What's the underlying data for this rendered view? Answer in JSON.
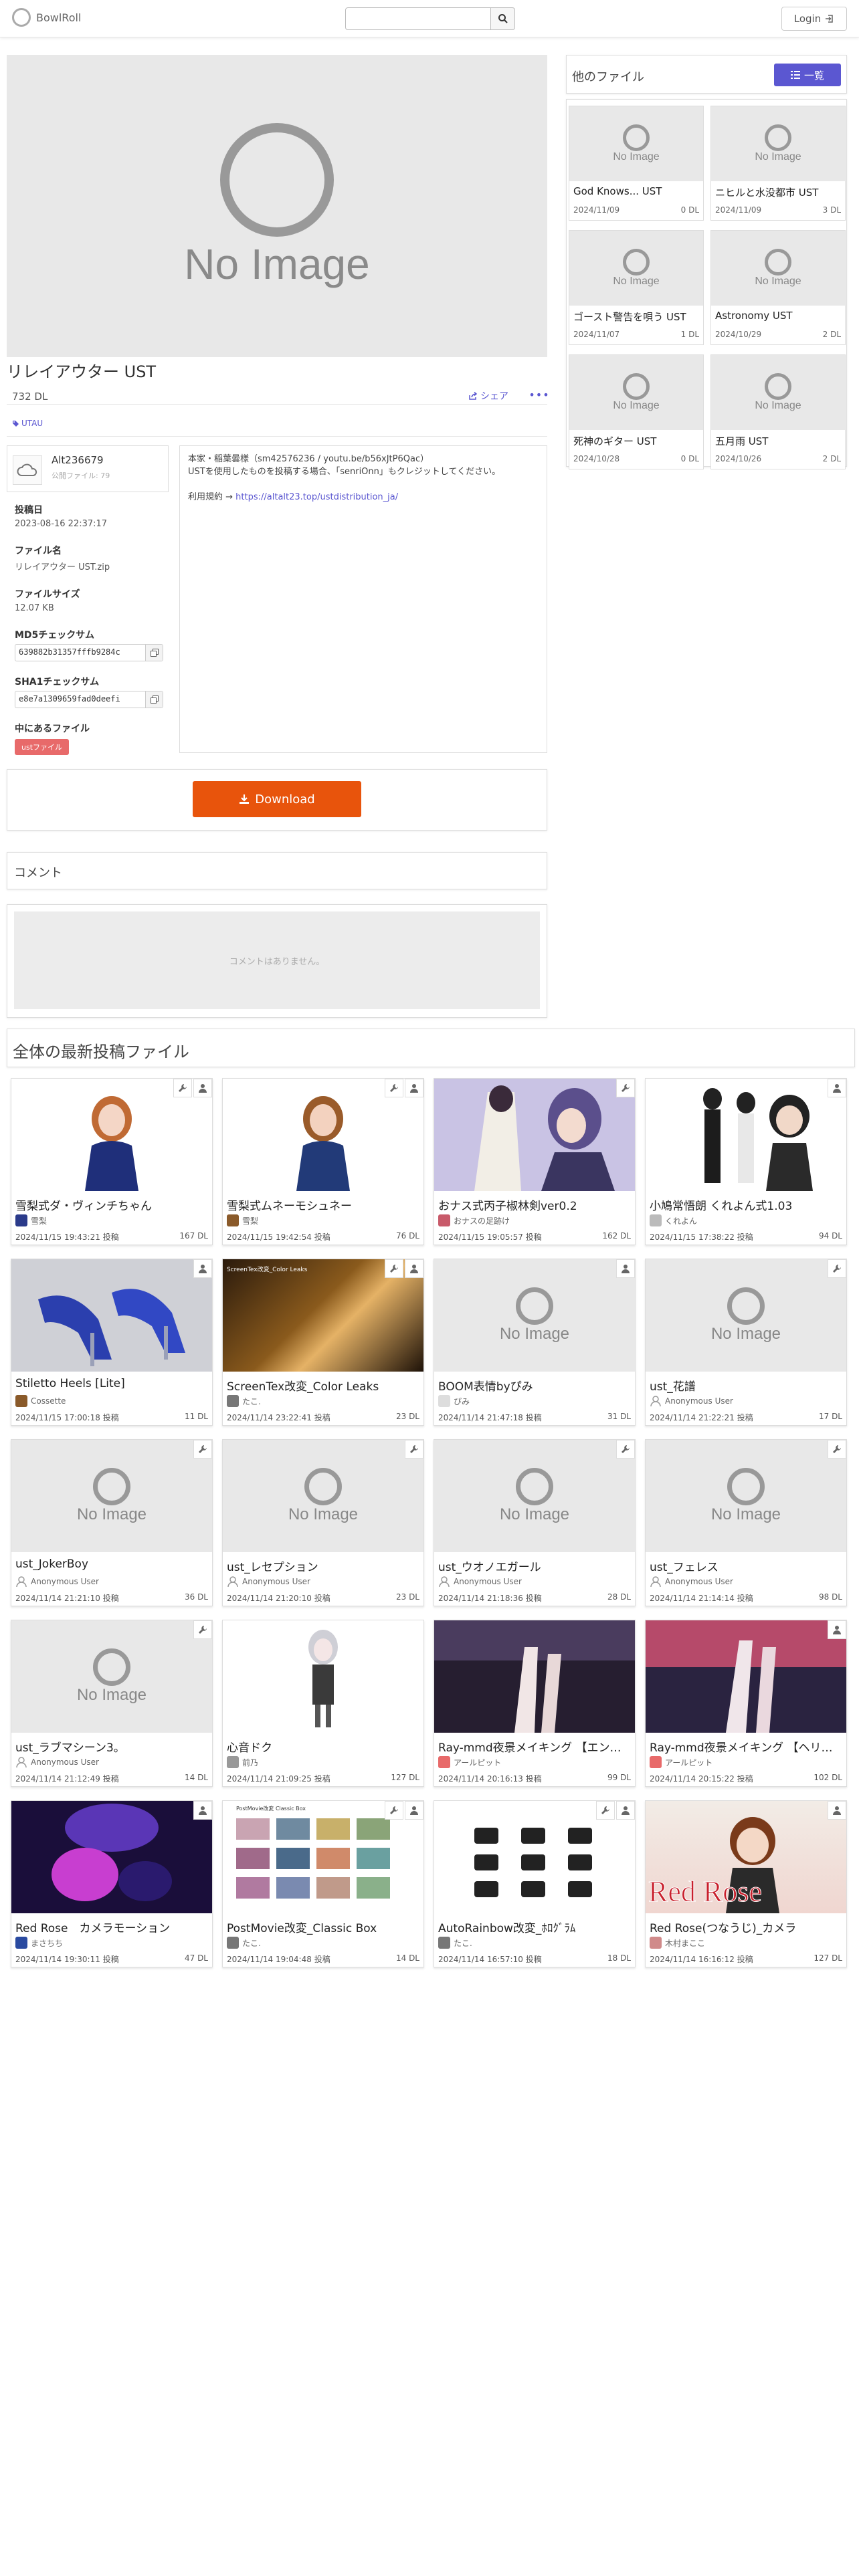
{
  "nav": {
    "brand": "BowlRoll",
    "search_placeholder": "",
    "login": "Login"
  },
  "file": {
    "no_image": "No Image",
    "title": "リレイアウター UST",
    "downloads": "732 DL",
    "share": "シェア",
    "tag": "UTAU",
    "user": {
      "name": "Alt236679",
      "files": "公開ファイル: 79"
    },
    "posted_label": "投稿日",
    "posted": "2023-08-16 22:37:17",
    "filename_label": "ファイル名",
    "filename": "リレイアウター UST.zip",
    "size_label": "ファイルサイズ",
    "size": "12.07 KB",
    "md5_label": "MD5チェックサム",
    "md5": "639882b31357fffb9284c",
    "sha1_label": "SHA1チェックサム",
    "sha1": "e8e7a1309659fad0deefi",
    "contents_label": "中にあるファイル",
    "contents_badge": "ustファイル",
    "description_line1": "本家・稲葉曇様（sm42576236 / youtu.be/b56xJtP6Qac）",
    "description_line2": "USTを使用したものを投稿する場合、「senriOnn」もクレジットしてください。",
    "terms_prefix": "利用規約 → ",
    "terms_link": "https://altalt23.top/ustdistribution_ja/",
    "download": "Download"
  },
  "comments": {
    "title": "コメント",
    "empty": "コメントはありません。"
  },
  "sidebar": {
    "title": "他のファイル",
    "list_button": "一覧",
    "items": [
      {
        "name": "God Knows... UST",
        "date": "2024/11/09",
        "dl": "0 DL"
      },
      {
        "name": "ニヒルと水没都市 UST",
        "date": "2024/11/09",
        "dl": "3 DL"
      },
      {
        "name": "ゴースト警告を唄う UST",
        "date": "2024/11/07",
        "dl": "1 DL"
      },
      {
        "name": "Astronomy UST",
        "date": "2024/10/29",
        "dl": "2 DL"
      },
      {
        "name": "死神のギター UST",
        "date": "2024/10/28",
        "dl": "0 DL"
      },
      {
        "name": "五月雨 UST",
        "date": "2024/10/26",
        "dl": "2 DL"
      }
    ]
  },
  "latest": {
    "title": "全体の最新投稿ファイル",
    "items": [
      {
        "title": "雪梨式ダ・ヴィンチちゃん",
        "author": "雪梨",
        "date": "2024/11/15 19:43:21 投稿",
        "dl": "167 DL"
      },
      {
        "title": "雪梨式ムネーモシュネー",
        "author": "雪梨",
        "date": "2024/11/15 19:42:54 投稿",
        "dl": "76 DL"
      },
      {
        "title": "おナス式丙子椒林剣ver0.2",
        "author": "おナスの足跡け",
        "date": "2024/11/15 19:05:57 投稿",
        "dl": "162 DL"
      },
      {
        "title": "小鳩常悟朗 くれよん式1.03",
        "author": "くれよん",
        "date": "2024/11/15 17:38:22 投稿",
        "dl": "94 DL"
      },
      {
        "title": "Stiletto Heels [Lite]",
        "author": "Cossette",
        "date": "2024/11/15 17:00:18 投稿",
        "dl": "11 DL"
      },
      {
        "title": "ScreenTex改変_Color Leaks",
        "author": "たこ.",
        "date": "2024/11/14 23:22:41 投稿",
        "dl": "23 DL"
      },
      {
        "title": "BOOM表情byぴみ",
        "author": "ぴみ",
        "date": "2024/11/14 21:47:18 投稿",
        "dl": "31 DL"
      },
      {
        "title": "ust_花譜",
        "author": "Anonymous User",
        "date": "2024/11/14 21:22:21 投稿",
        "dl": "17 DL"
      },
      {
        "title": "ust_JokerBoy",
        "author": "Anonymous User",
        "date": "2024/11/14 21:21:10 投稿",
        "dl": "36 DL"
      },
      {
        "title": "ust_レセプション",
        "author": "Anonymous User",
        "date": "2024/11/14 21:20:10 投稿",
        "dl": "23 DL"
      },
      {
        "title": "ust_ウオノエガール",
        "author": "Anonymous User",
        "date": "2024/11/14 21:18:36 投稿",
        "dl": "28 DL"
      },
      {
        "title": "ust_フェレス",
        "author": "Anonymous User",
        "date": "2024/11/14 21:14:14 投稿",
        "dl": "98 DL"
      },
      {
        "title": "ust_ラブマシーン3。",
        "author": "Anonymous User",
        "date": "2024/11/14 21:12:49 投稿",
        "dl": "14 DL"
      },
      {
        "title": "心音ドク",
        "author": "前乃",
        "date": "2024/11/14 21:09:25 投稿",
        "dl": "127 DL"
      },
      {
        "title": "Ray-mmd夜景メイキング 【エン…",
        "author": "アールピット",
        "date": "2024/11/14 20:16:13 投稿",
        "dl": "99 DL"
      },
      {
        "title": "Ray-mmd夜景メイキング 【ヘリ…",
        "author": "アールピット",
        "date": "2024/11/14 20:15:22 投稿",
        "dl": "102 DL"
      },
      {
        "title": "Red Rose　カメラモーション",
        "author": "まさちち",
        "date": "2024/11/14 19:30:11 投稿",
        "dl": "47 DL"
      },
      {
        "title": "PostMovie改変_Classic Box",
        "author": "たこ.",
        "date": "2024/11/14 19:04:48 投稿",
        "dl": "14 DL"
      },
      {
        "title": "AutoRainbow改変_ﾎﾛｸﾞﾗﾑ",
        "author": "たこ.",
        "date": "2024/11/14 16:57:10 投稿",
        "dl": "18 DL"
      },
      {
        "title": "Red Rose(つなうじ)_カメラ",
        "author": "木村まここ",
        "date": "2024/11/14 16:16:12 投稿",
        "dl": "127 DL"
      }
    ],
    "thumb_texts": {
      "screentex": "ScreenTex改変_Color Leaks",
      "classicbox": "PostMovie改変 Classic Box",
      "redrose": "Red Rose"
    }
  },
  "colors": {
    "accent": "#5b57d1",
    "download": "#e8540c",
    "link": "#5b57d1",
    "badge_red": "#e86a6a"
  }
}
